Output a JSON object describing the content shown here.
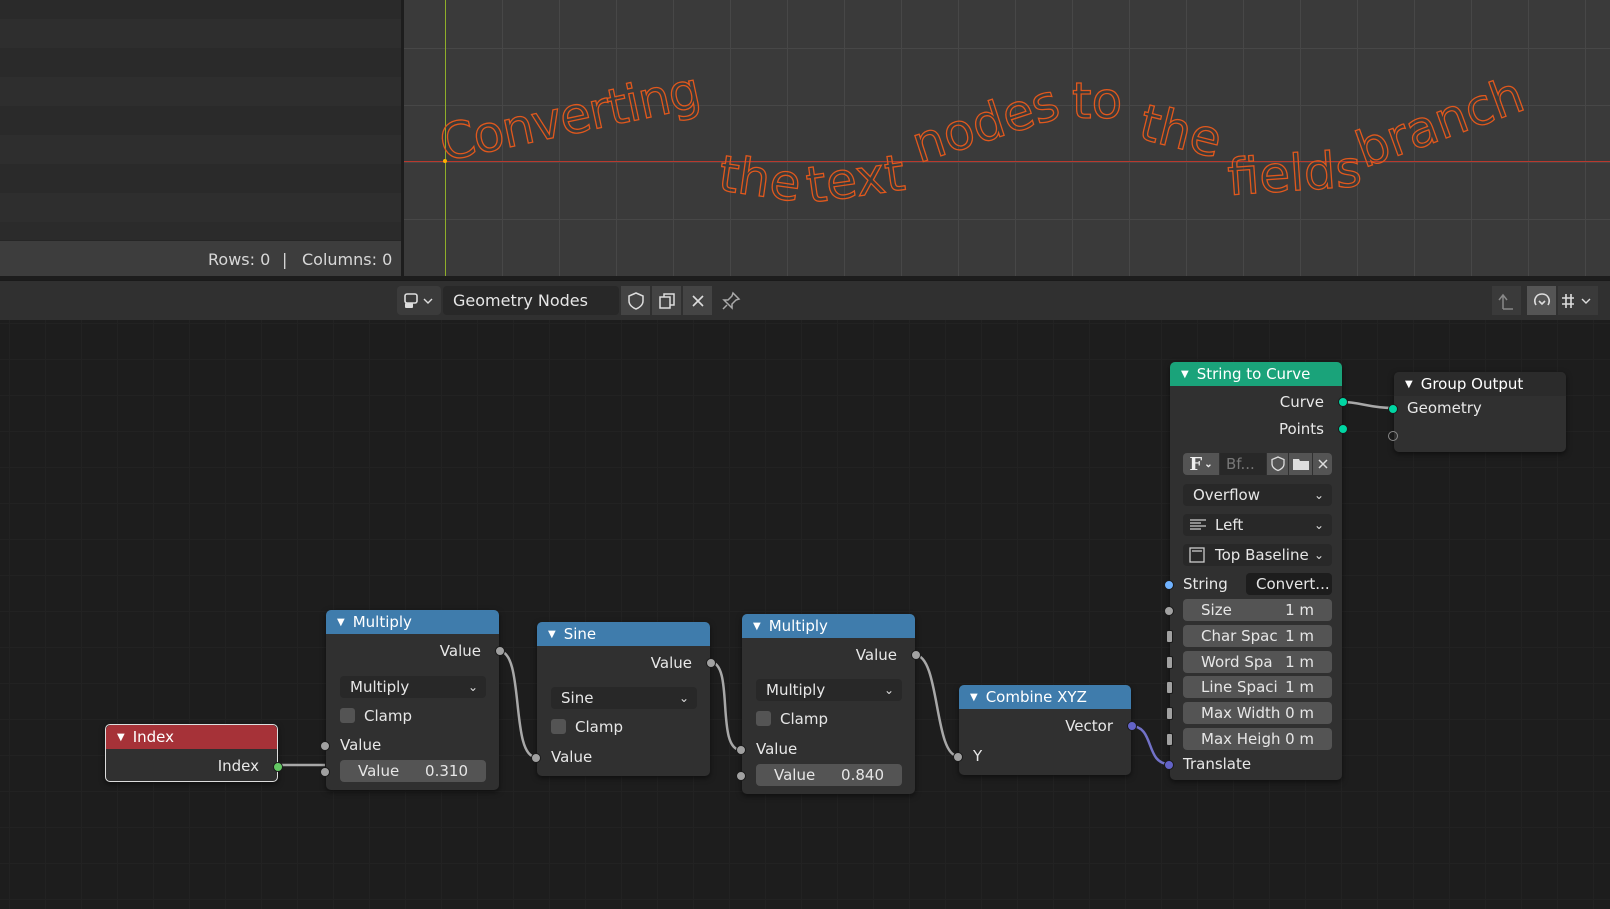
{
  "spreadsheet": {
    "rows_label": "Rows: 0",
    "separator": "|",
    "columns_label": "Columns: 0"
  },
  "viewport": {
    "text_words": [
      "Converting",
      "the",
      "text",
      "nodes",
      "to",
      "the",
      "fields",
      "branch"
    ],
    "text_color": "#e0581d"
  },
  "header": {
    "editor_type_icon": "node-editor-icon",
    "node_group_name": "Geometry Nodes",
    "fake_user_icon": "shield-icon",
    "duplicate_icon": "duplicate-icon",
    "unlink_icon": "close-icon",
    "pin_icon": "pin-icon",
    "parent_icon": "arrow-up-icon",
    "snap_icon": "snap-icon",
    "overlay_icon": "overlay-icon"
  },
  "nodes": {
    "index": {
      "title": "Index",
      "out_label": "Index",
      "color": "#a63238"
    },
    "multiply1": {
      "title": "Multiply",
      "out_label": "Value",
      "operation": "Multiply",
      "clamp_label": "Clamp",
      "in_label": "Value",
      "value_label": "Value",
      "value": "0.310",
      "color": "#3f7cac"
    },
    "sine": {
      "title": "Sine",
      "out_label": "Value",
      "operation": "Sine",
      "clamp_label": "Clamp",
      "in_label": "Value",
      "color": "#3f7cac"
    },
    "multiply2": {
      "title": "Multiply",
      "out_label": "Value",
      "operation": "Multiply",
      "clamp_label": "Clamp",
      "in_label": "Value",
      "value_label": "Value",
      "value": "0.840",
      "color": "#3f7cac"
    },
    "combine": {
      "title": "Combine XYZ",
      "out_label": "Vector",
      "in_label": "Y",
      "color": "#3f7cac"
    },
    "string_to_curve": {
      "title": "String to Curve",
      "out_curve": "Curve",
      "out_points": "Points",
      "font_icon": "F",
      "font_name": "Bf...",
      "overflow": "Overflow",
      "align_x": "Left",
      "align_y": "Top Baseline",
      "string_label": "String",
      "string_value": "Convert...",
      "fields": [
        {
          "label": "Size",
          "value": "1 m"
        },
        {
          "label": "Char Spac",
          "value": "1 m"
        },
        {
          "label": "Word Spa",
          "value": "1 m"
        },
        {
          "label": "Line Spaci",
          "value": "1 m"
        },
        {
          "label": "Max Width",
          "value": "0 m"
        },
        {
          "label": "Max Heigh",
          "value": "0 m"
        }
      ],
      "translate_label": "Translate",
      "color": "#1aa37a"
    },
    "group_output": {
      "title": "Group Output",
      "in_label": "Geometry"
    }
  }
}
